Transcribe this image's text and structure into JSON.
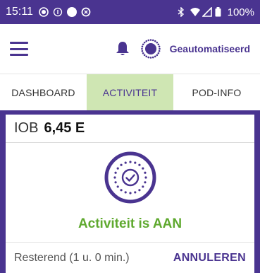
{
  "status_bar": {
    "time": "15:11",
    "battery": "100%",
    "icons": [
      "record-icon",
      "info-icon",
      "circle-icon",
      "target-icon",
      "bluetooth-icon",
      "wifi-icon",
      "signal-icon",
      "battery-icon"
    ]
  },
  "header": {
    "mode_label": "Geautomatiseerd",
    "icons": [
      "menu-icon",
      "bell-icon",
      "automated-mode-icon"
    ]
  },
  "tabs": [
    {
      "label": "DASHBOARD",
      "active": false
    },
    {
      "label": "ACTIVITEIT",
      "active": true
    },
    {
      "label": "POD-INFO",
      "active": false
    }
  ],
  "iob": {
    "label": "IOB",
    "value": "6,45 E"
  },
  "activity": {
    "status": "Activiteit is AAN",
    "remaining": "Resterend (1 u. 0 min.)",
    "cancel_label": "ANNULEREN"
  },
  "colors": {
    "brand_purple": "#4a3490",
    "active_tab_bg": "#cfe6b3",
    "status_green": "#5fa92f"
  }
}
